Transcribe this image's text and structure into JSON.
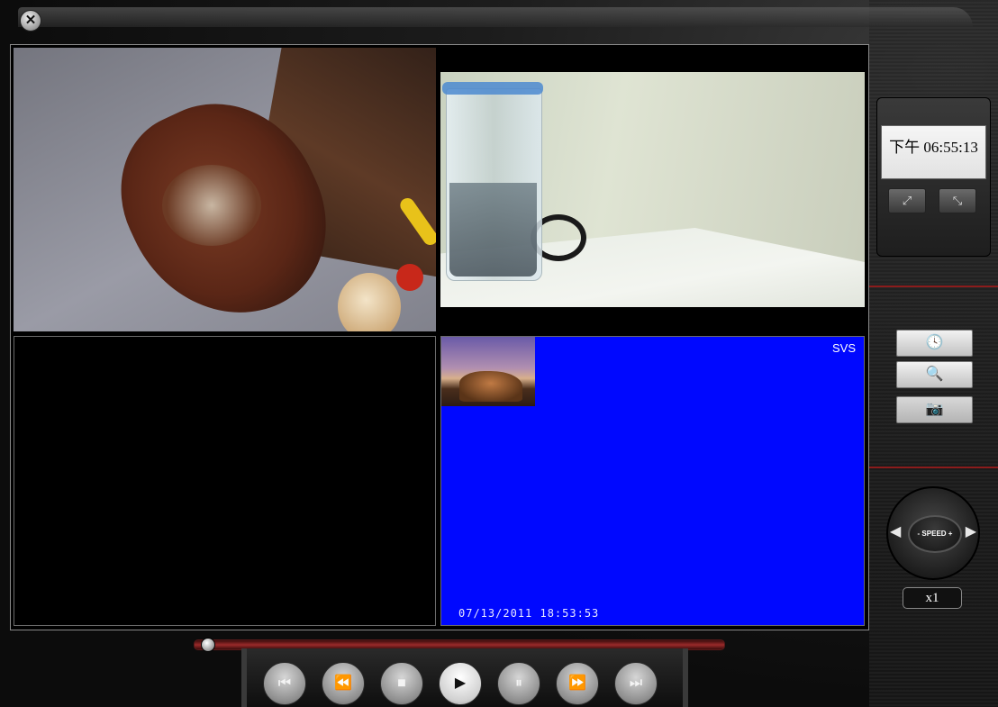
{
  "window": {
    "close_label": "✕"
  },
  "channels": [
    {
      "name": "channel-1"
    },
    {
      "name": "channel-2"
    },
    {
      "name": "channel-3"
    },
    {
      "name": "channel-4",
      "osd_title": "SVS",
      "osd_timestamp": "07/13/2011  18:53:53"
    }
  ],
  "clock": {
    "time": "下午 06:55:13"
  },
  "layout_buttons": {
    "fullscreen_glyph": "⤢",
    "restore_glyph": "⤡"
  },
  "tools": {
    "schedule_glyph": "🕓",
    "search_glyph": "🔍",
    "snapshot_glyph": "📷",
    "snapshot_disabled": true
  },
  "speed": {
    "label": "- SPEED +",
    "left_arrow": "◀",
    "right_arrow": "▶",
    "value": "x1"
  },
  "playback": {
    "progress": 0.0,
    "buttons": [
      {
        "name": "skip-to-start-button",
        "glyph": "⏮"
      },
      {
        "name": "previous-frame-button",
        "glyph": "⏪"
      },
      {
        "name": "stop-button",
        "glyph": "■"
      },
      {
        "name": "play-button",
        "glyph": "▶",
        "active": true
      },
      {
        "name": "pause-button",
        "glyph": "⏸"
      },
      {
        "name": "next-frame-button",
        "glyph": "⏩"
      },
      {
        "name": "skip-to-end-button",
        "glyph": "⏭"
      }
    ]
  },
  "colors": {
    "osd_background": "#0008ff",
    "accent_red": "#8b1c1c"
  }
}
